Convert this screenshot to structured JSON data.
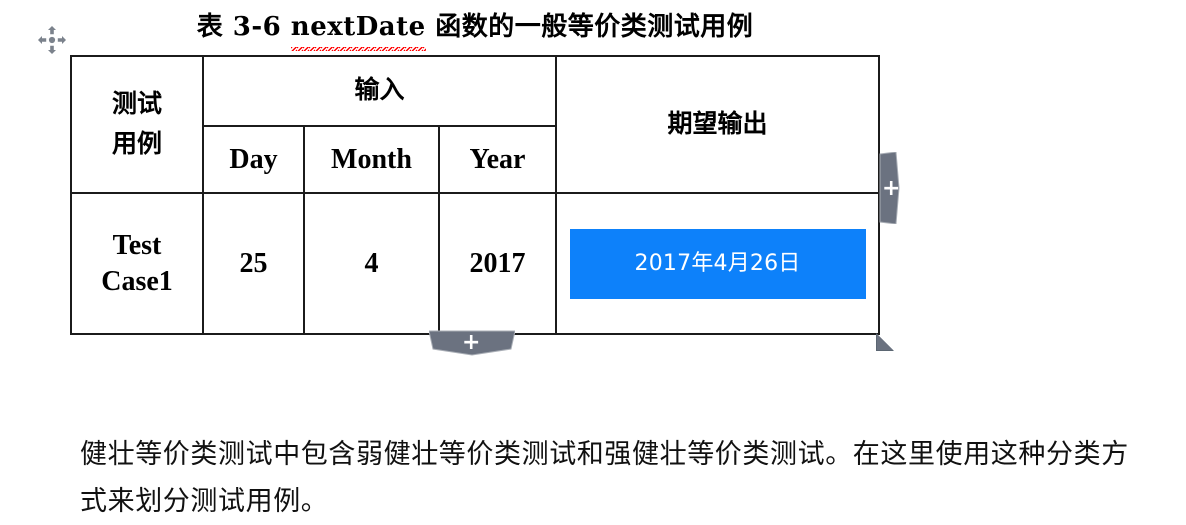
{
  "document": {
    "caption": {
      "prefix": "表 3-6 ",
      "misspelled_word": "nextDate",
      "suffix": " 函数的一般等价类测试用例"
    },
    "table": {
      "header_row_1": {
        "test_case_label": "测试",
        "input_group_label": "输入",
        "expected_output_label": "期望输出"
      },
      "header_row_2": {
        "test_case_label_line2": "用例",
        "day_label": "Day",
        "month_label": "Month",
        "year_label": "Year"
      },
      "rows": [
        {
          "case_line1": "Test",
          "case_line2": "Case1",
          "day": "25",
          "month": "4",
          "year": "2017",
          "expected_output": "2017年4月26日",
          "expected_output_highlighted": true
        }
      ]
    },
    "paragraph": "健壮等价类测试中包含弱健壮等价类测试和强健壮等价类测试。在这里使用这种分类方式来划分测试用例。"
  },
  "handles": {
    "move_handle_name": "table-move-handle",
    "insert_column_plus": "+",
    "insert_row_plus": "+",
    "resize_handle_name": "table-resize-handle"
  },
  "colors": {
    "selection_highlight": "#0d81fa",
    "selection_text": "#ffffff",
    "table_border": "#1b1b1b",
    "handle_gray": "#6b7280",
    "spellcheck_red": "#ff0000",
    "text": "#000000"
  }
}
